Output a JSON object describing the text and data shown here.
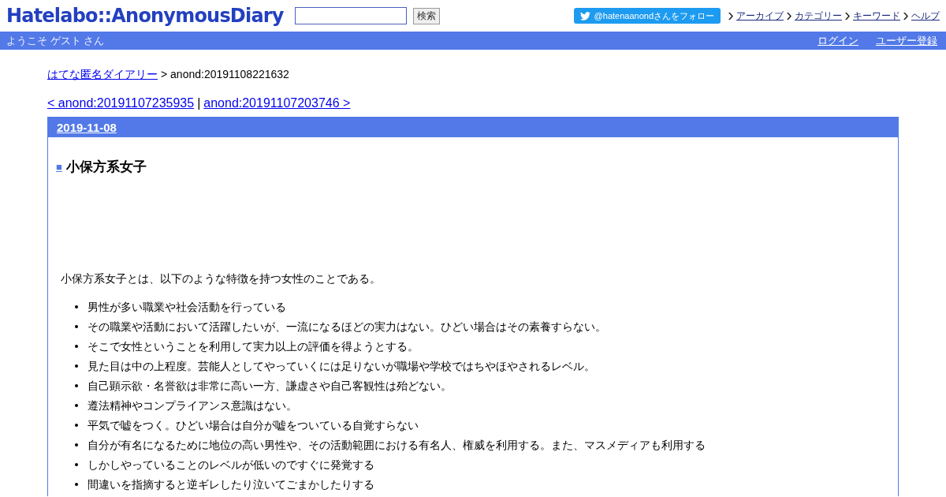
{
  "header": {
    "logo": "Hatelabo::AnonymousDiary",
    "search": {
      "button": "検索"
    },
    "follow_button": "@hatenaanondさんをフォロー",
    "links": [
      "アーカイブ",
      "カテゴリー",
      "キーワード",
      "ヘルプ"
    ]
  },
  "user_bar": {
    "welcome": "ようこそ ゲスト さん",
    "links": [
      "ログイン",
      "ユーザー登録"
    ]
  },
  "breadcrumb": {
    "link": "はてな匿名ダイアリー",
    "current": "> anond:20191108221632"
  },
  "pager": {
    "prev": "< anond:20191107235935",
    "separator": "|",
    "next": "anond:20191107203746 >"
  },
  "day": {
    "date": "2019-11-08",
    "mark": "■",
    "title": "小保方系女子",
    "intro": "小保方系女子とは、以下のような特徴を持つ女性のことである。",
    "items": [
      "男性が多い職業や社会活動を行っている",
      "その職業や活動において活躍したいが、一流になるほどの実力はない。ひどい場合はその素養すらない。",
      "そこで女性ということを利用して実力以上の評価を得ようとする。",
      "見た目は中の上程度。芸能人としてやっていくには足りないが職場や学校ではちやほやされるレベル。",
      "自己顕示欲・名誉欲は非常に高い一方、謙虚さや自己客観性は殆どない。",
      "遵法精神やコンプライアンス意識はない。",
      "平気で嘘をつく。ひどい場合は自分が嘘をついている自覚すらない",
      "自分が有名になるために地位の高い男性や、その活動範囲における有名人、権威を利用する。また、マスメディアも利用する",
      "しかしやっていることのレベルが低いのですぐに発覚する",
      "間違いを指摘すると逆ギレしたり泣いてごまかしたりする"
    ]
  }
}
